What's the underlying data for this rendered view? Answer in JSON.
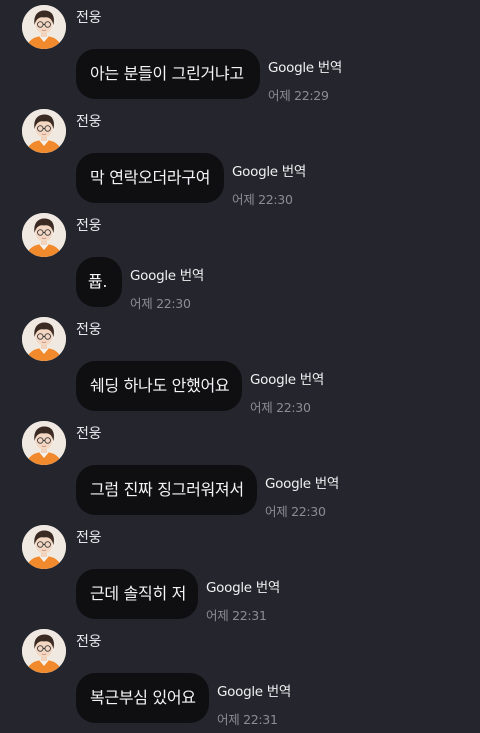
{
  "sender_name": "전웅",
  "translate_label": "Google 번역",
  "messages": [
    {
      "text": "아는 분들이 그린거냐고",
      "time": "어제 22:29"
    },
    {
      "text": "막 연락오더라구여",
      "time": "어제 22:30"
    },
    {
      "text": "퓹.",
      "time": "어제 22:30"
    },
    {
      "text": "쉐딩 하나도 안했어요",
      "time": "어제 22:30"
    },
    {
      "text": "그럼 진짜 징그러워져서",
      "time": "어제 22:30"
    },
    {
      "text": "근데 솔직히 저",
      "time": "어제 22:31"
    },
    {
      "text": "복근부심 있어요",
      "time": "어제 22:31"
    }
  ],
  "colors": {
    "background": "#25252d",
    "bubble": "#0f0f12",
    "timestamp": "#8c8c95",
    "avatar_shirt": "#f08a2c"
  },
  "icons": {
    "avatar": "profile-photo"
  }
}
